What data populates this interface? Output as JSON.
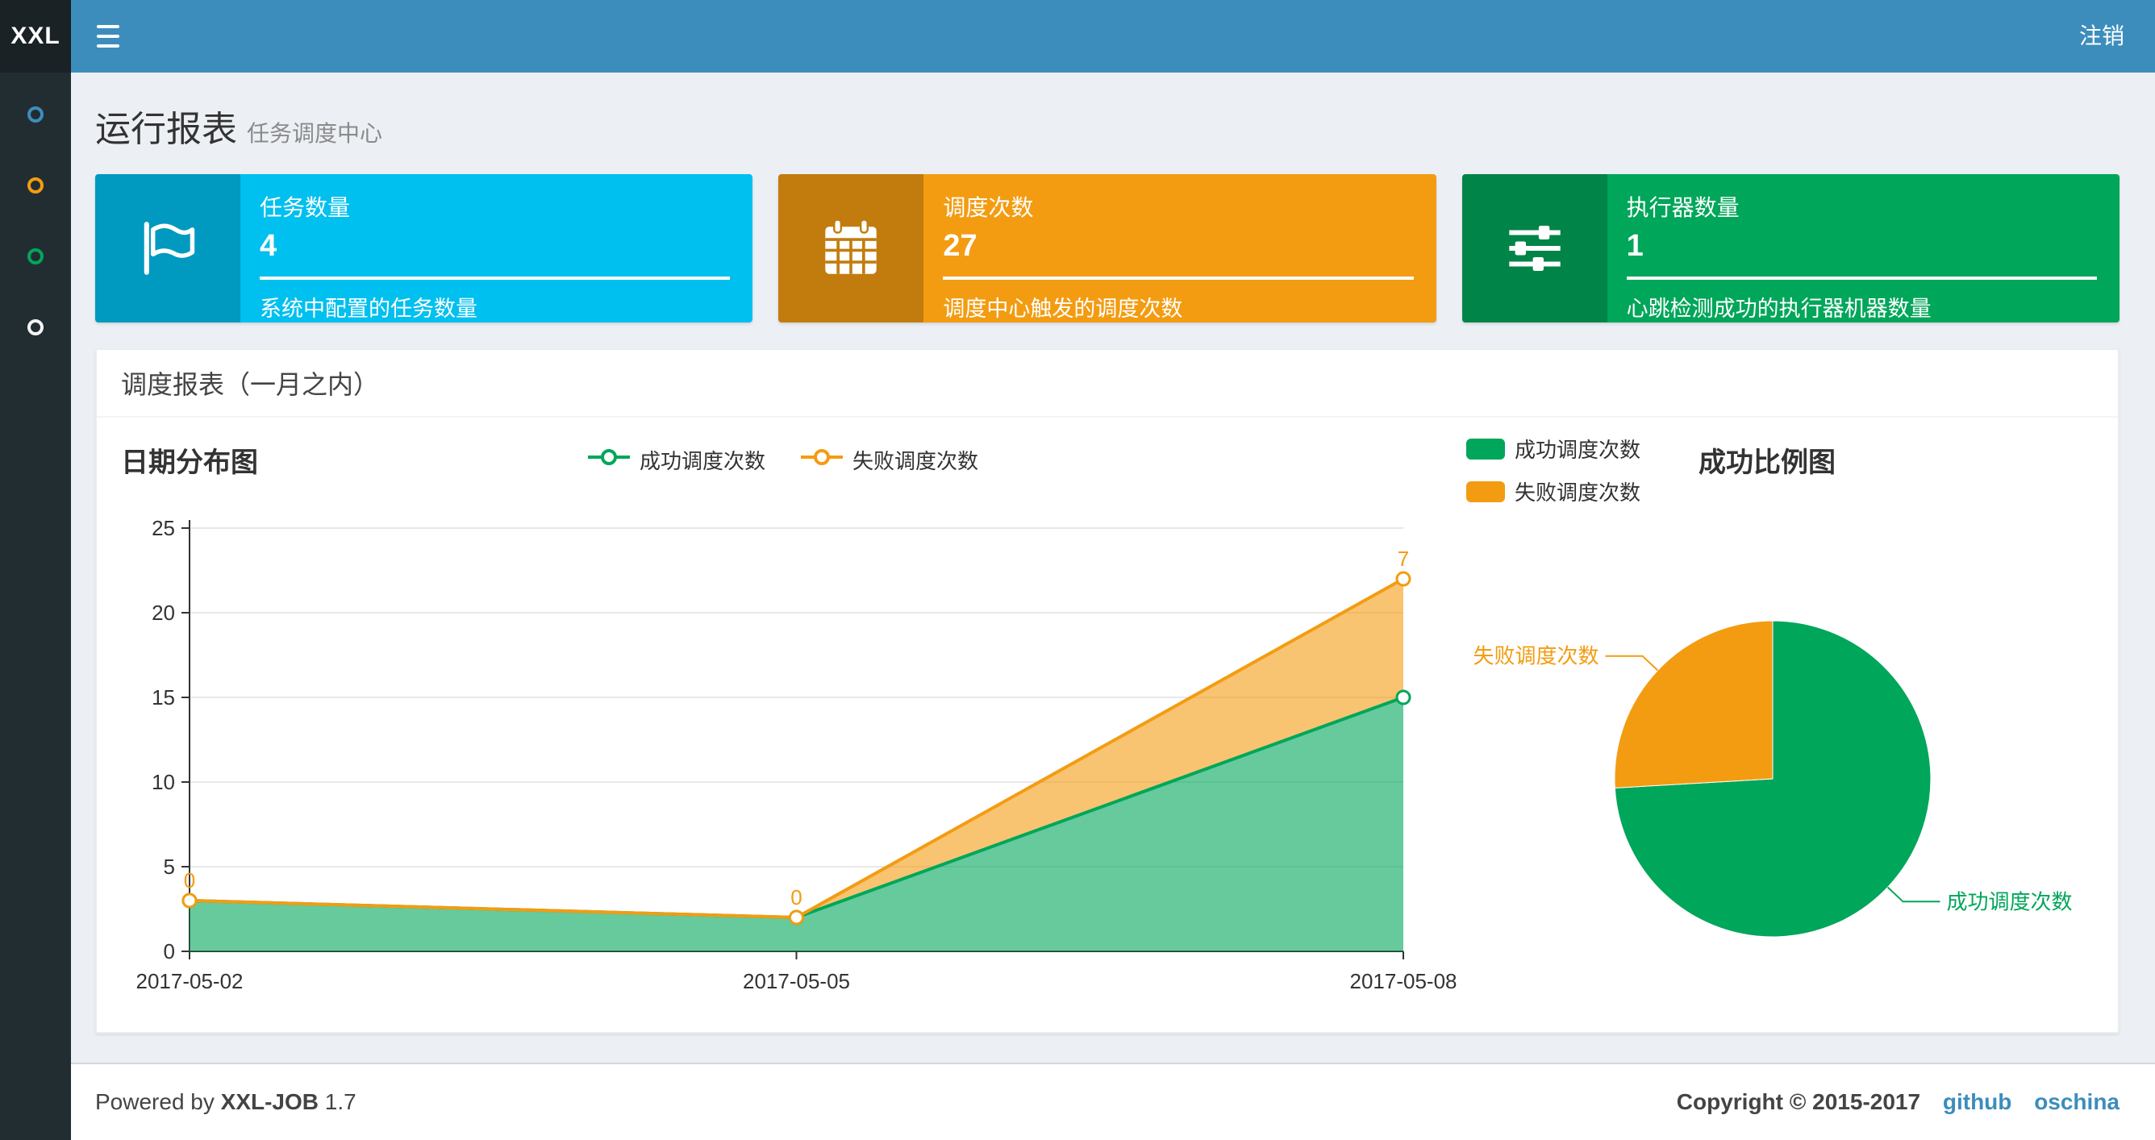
{
  "theme": {
    "navbar_bg": "#3c8dbc",
    "logo_bg": "#1a2226",
    "sidebar_bg": "#222d32",
    "content_bg": "#ecf0f5",
    "aqua": "#00c0ef",
    "orange": "#f39c12",
    "green": "#00a65a",
    "link_blue": "#3c8dbc"
  },
  "navbar": {
    "logo": "XXL",
    "logout_label": "注销"
  },
  "sidebar": {
    "items": [
      {
        "color": "#3c8dbc"
      },
      {
        "color": "#f39c12"
      },
      {
        "color": "#00a65a"
      },
      {
        "color": "#f4f4f4"
      }
    ]
  },
  "page_header": {
    "title": "运行报表",
    "subtitle": "任务调度中心"
  },
  "info_boxes": [
    {
      "label": "任务数量",
      "value": "4",
      "description": "系统中配置的任务数量",
      "color": "#00c0ef",
      "icon": "flag-icon"
    },
    {
      "label": "调度次数",
      "value": "27",
      "description": "调度中心触发的调度次数",
      "color": "#f39c12",
      "icon": "calendar-icon"
    },
    {
      "label": "执行器数量",
      "value": "1",
      "description": "心跳检测成功的执行器机器数量",
      "color": "#00a65a",
      "icon": "sliders-icon"
    }
  ],
  "panel": {
    "title": "调度报表（一月之内）"
  },
  "chart_data": [
    {
      "type": "area",
      "title": "日期分布图",
      "stacked": true,
      "x": [
        "2017-05-02",
        "2017-05-05",
        "2017-05-08"
      ],
      "series": [
        {
          "name": "成功调度次数",
          "values": [
            3,
            2,
            15
          ],
          "color": "#00a65a",
          "show_labels": false
        },
        {
          "name": "失败调度次数",
          "values": [
            0,
            0,
            7
          ],
          "color": "#f39c12",
          "show_labels": true
        }
      ],
      "ylim": [
        0,
        25
      ],
      "yticks": [
        0,
        5,
        10,
        15,
        20,
        25
      ],
      "grid": true,
      "legend_position": "top-center"
    },
    {
      "type": "pie",
      "title": "成功比例图",
      "slices": [
        {
          "name": "成功调度次数",
          "value": 20,
          "color": "#00a65a"
        },
        {
          "name": "失败调度次数",
          "value": 7,
          "color": "#f39c12"
        }
      ],
      "legend_position": "top-left"
    }
  ],
  "footer": {
    "powered_by_prefix": "Powered by",
    "product": "XXL-JOB",
    "version": "1.7",
    "copyright": "Copyright © 2015-2017",
    "links": [
      "github",
      "oschina"
    ]
  }
}
